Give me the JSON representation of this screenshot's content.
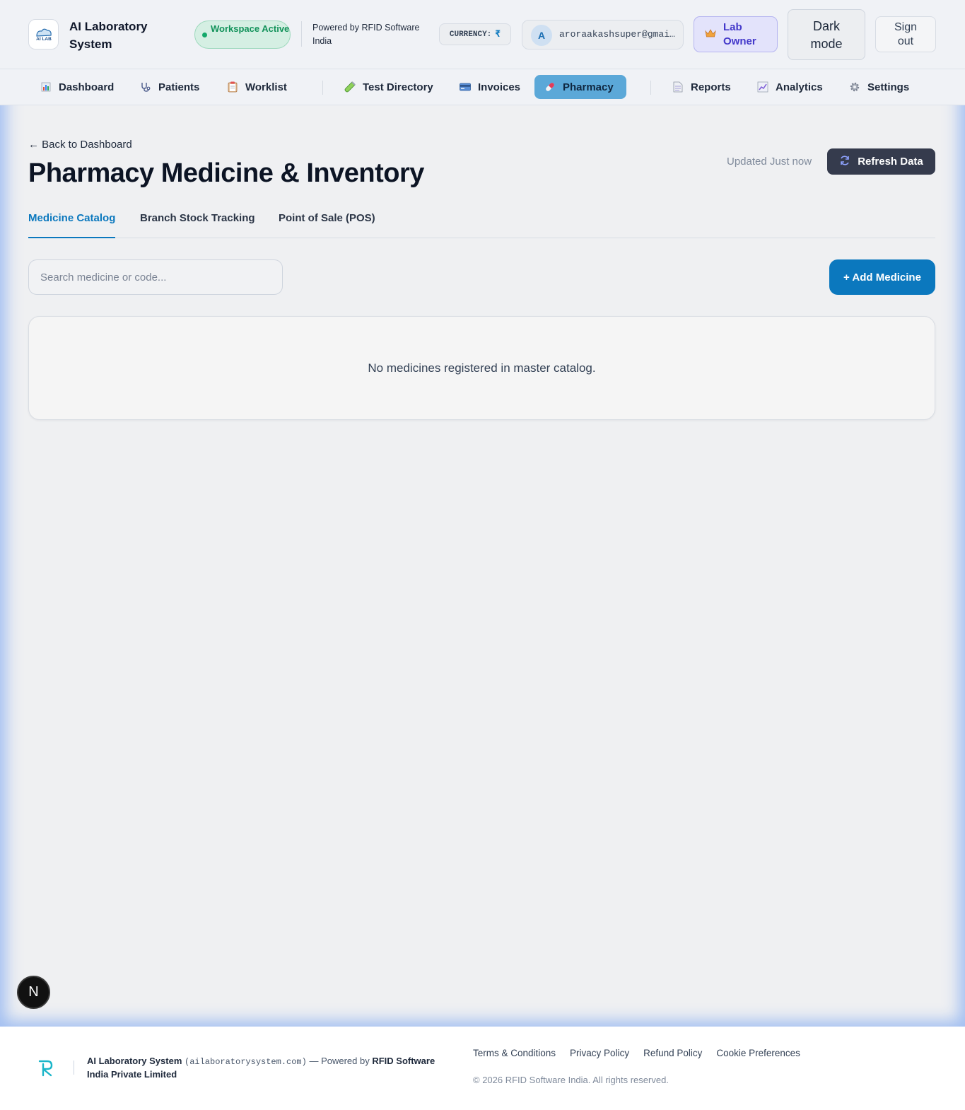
{
  "header": {
    "app_title": "AI Laboratory System",
    "logo_text": "AI LAB",
    "workspace_status": "Workspace Active",
    "powered_by": "Powered by RFID Software India",
    "currency_label": "CURRENCY:",
    "currency_symbol": "₹",
    "user_initial": "A",
    "user_email": "aroraakashsuper@gmai…",
    "role_label": "Lab Owner",
    "dark_mode_label": "Dark mode",
    "sign_out_label": "Sign out"
  },
  "nav": {
    "items": [
      {
        "label": "Dashboard",
        "icon": "bar-chart-icon"
      },
      {
        "label": "Patients",
        "icon": "stethoscope-icon"
      },
      {
        "label": "Worklist",
        "icon": "clipboard-icon"
      },
      {
        "label": "Test Directory",
        "icon": "test-tube-icon"
      },
      {
        "label": "Invoices",
        "icon": "credit-card-icon"
      },
      {
        "label": "Pharmacy",
        "icon": "pill-icon",
        "active": true
      },
      {
        "label": "Reports",
        "icon": "document-icon"
      },
      {
        "label": "Analytics",
        "icon": "line-chart-icon"
      },
      {
        "label": "Settings",
        "icon": "gear-icon"
      }
    ]
  },
  "page": {
    "back_link": "← Back to Dashboard",
    "title": "Pharmacy Medicine & Inventory",
    "updated_text": "Updated Just now",
    "refresh_label": "Refresh Data",
    "tabs": [
      {
        "label": "Medicine Catalog",
        "active": true
      },
      {
        "label": "Branch Stock Tracking"
      },
      {
        "label": "Point of Sale (POS)"
      }
    ],
    "search_placeholder": "Search medicine or code...",
    "search_value": "",
    "add_medicine_label": "+ Add Medicine",
    "empty_message": "No medicines registered in master catalog."
  },
  "overlay": {
    "badge_letter": "N"
  },
  "footer": {
    "brand_name": "AI Laboratory System",
    "domain": "(ailaboratorysystem.com)",
    "powered_prefix": "— Powered by",
    "company": "RFID Software India Private Limited",
    "links": [
      "Terms & Conditions",
      "Privacy Policy",
      "Refund Policy",
      "Cookie Preferences"
    ],
    "copyright": "© 2026 RFID Software India. All rights reserved."
  },
  "colors": {
    "accent": "#0b78be",
    "active_nav": "#5ba8d8",
    "refresh_button": "#353b4d",
    "workspace_badge": "#d5efe3",
    "role_badge": "#e3e3fb"
  }
}
